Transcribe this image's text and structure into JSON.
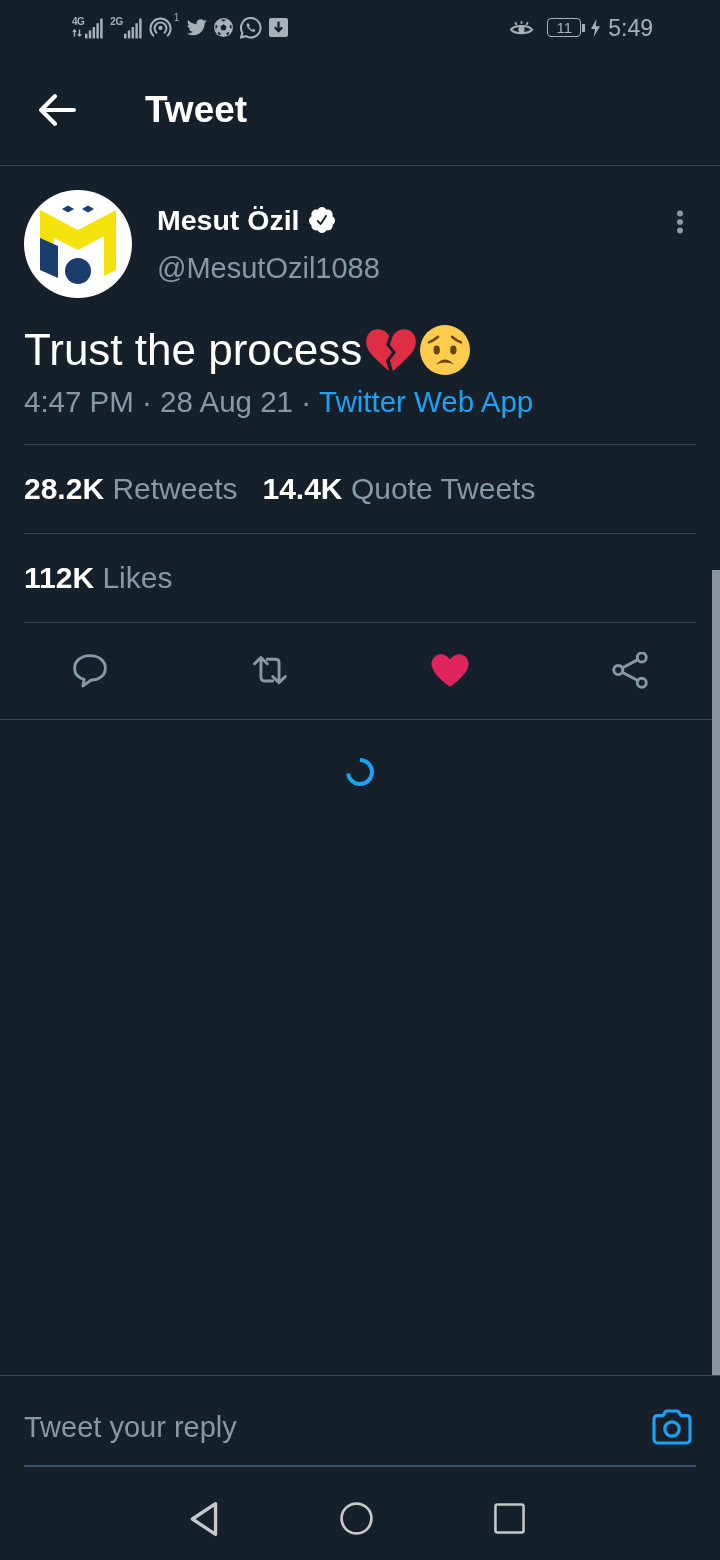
{
  "status_bar": {
    "left": [
      {
        "kind": "signal",
        "label": "4G",
        "data_active": true
      },
      {
        "kind": "signal",
        "label": "2G",
        "data_active": false
      },
      {
        "kind": "hotspot",
        "badge": "1"
      },
      {
        "kind": "bird"
      },
      {
        "kind": "soccer"
      },
      {
        "kind": "chat"
      },
      {
        "kind": "download"
      }
    ],
    "right": [
      {
        "kind": "eye"
      },
      {
        "kind": "battery",
        "label": "11",
        "charging": true
      }
    ],
    "time": "5:49"
  },
  "header": {
    "title": "Tweet"
  },
  "tweet": {
    "author": {
      "name": "Mesut Özil",
      "verified": true,
      "handle": "@MesutOzil1088"
    },
    "text": "Trust the process",
    "emojis": [
      {
        "kind": "broken_heart"
      },
      {
        "kind": "worried_face"
      }
    ],
    "timestamp": "4:47 PM · 28 Aug 21 ·",
    "source": "Twitter Web App",
    "stats": [
      {
        "count": "28.2K",
        "label": "Retweets"
      },
      {
        "count": "14.4K",
        "label": "Quote Tweets"
      }
    ],
    "likes": {
      "count": "112K",
      "label": "Likes"
    },
    "actions": [
      {
        "kind": "reply",
        "active": false
      },
      {
        "kind": "retweet",
        "active": false
      },
      {
        "kind": "like",
        "active": true
      },
      {
        "kind": "share",
        "active": false
      }
    ]
  },
  "replies": {
    "loading": true
  },
  "reply_bar": {
    "placeholder": "Tweet your reply"
  },
  "nav_bar": [
    {
      "kind": "back"
    },
    {
      "kind": "home"
    },
    {
      "kind": "recents"
    }
  ]
}
